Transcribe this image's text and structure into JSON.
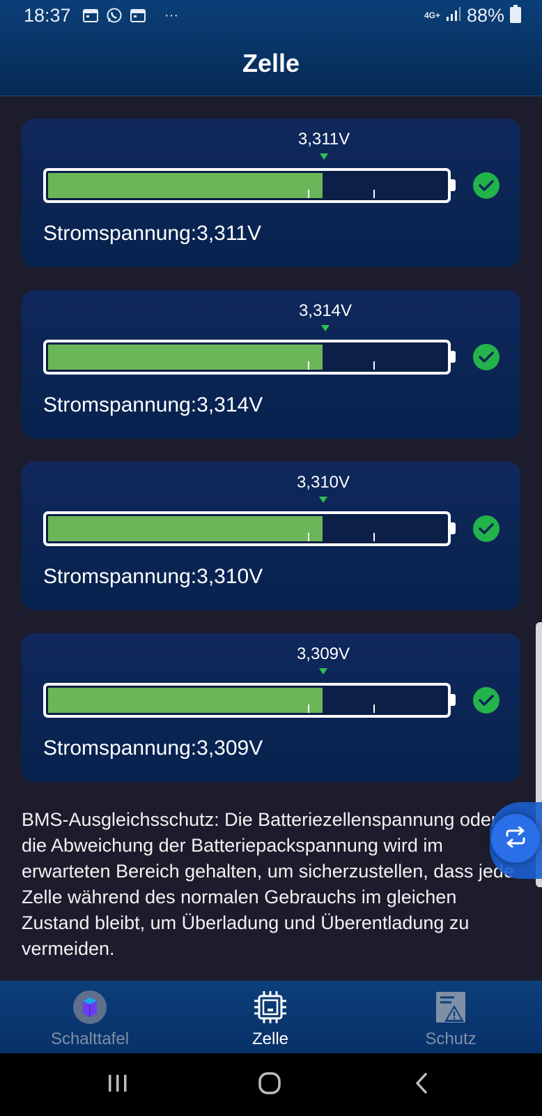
{
  "status_bar": {
    "time": "18:37",
    "more": "···",
    "network": "4G+",
    "battery": "88%"
  },
  "header": {
    "title": "Zelle"
  },
  "cells": [
    {
      "marker": "3,311V",
      "voltage_text": "Stromspannung:3,311V",
      "fill_fraction": 0.69,
      "status": "ok"
    },
    {
      "marker": "3,314V",
      "voltage_text": "Stromspannung:3,314V",
      "fill_fraction": 0.69,
      "status": "ok"
    },
    {
      "marker": "3,310V",
      "voltage_text": "Stromspannung:3,310V",
      "fill_fraction": 0.69,
      "status": "ok"
    },
    {
      "marker": "3,309V",
      "voltage_text": "Stromspannung:3,309V",
      "fill_fraction": 0.69,
      "status": "ok"
    }
  ],
  "info": {
    "text": "BMS-Ausgleichsschutz: Die Batteriezellenspannung oder die Abweichung der Batteriepackspannung wird im erwarteten Bereich gehalten, um sicherzustellen, dass jede Zelle während des normalen Gebrauchs im gleichen Zustand bleibt, um Überladung und Überentladung zu vermeiden."
  },
  "bottom_nav": [
    {
      "label": "Schalttafel",
      "icon": "battery-cube-icon",
      "active": false
    },
    {
      "label": "Zelle",
      "icon": "chip-icon",
      "active": true
    },
    {
      "label": "Schutz",
      "icon": "warning-doc-icon",
      "active": false
    }
  ],
  "colors": {
    "fill_green": "#6cb65a",
    "check_green": "#22b44b",
    "card_bg": "#0b2556",
    "page_bg": "#1c1c2c"
  }
}
